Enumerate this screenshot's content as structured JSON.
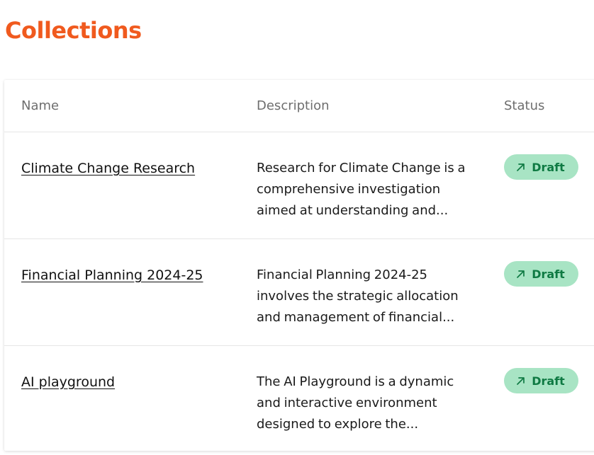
{
  "page": {
    "title": "Collections"
  },
  "table": {
    "columns": {
      "name": "Name",
      "description": "Description",
      "status": "Status"
    },
    "rows": [
      {
        "name": "Climate Change Research",
        "description": "Research for Climate Change is a comprehensive investigation aimed at understanding and...",
        "status": "Draft",
        "status_icon": "arrow-up-right-icon"
      },
      {
        "name": "Financial Planning 2024-25",
        "description": "Financial Planning 2024-25 involves the strategic allocation and management of financial...",
        "status": "Draft",
        "status_icon": "arrow-up-right-icon"
      },
      {
        "name": "AI playground",
        "description": "The AI Playground is a dynamic and interactive environment designed to explore the...",
        "status": "Draft",
        "status_icon": "arrow-up-right-icon"
      }
    ]
  },
  "colors": {
    "title": "#f05a1e",
    "badge_bg": "#a8e4c4",
    "badge_text": "#0f7a43"
  }
}
